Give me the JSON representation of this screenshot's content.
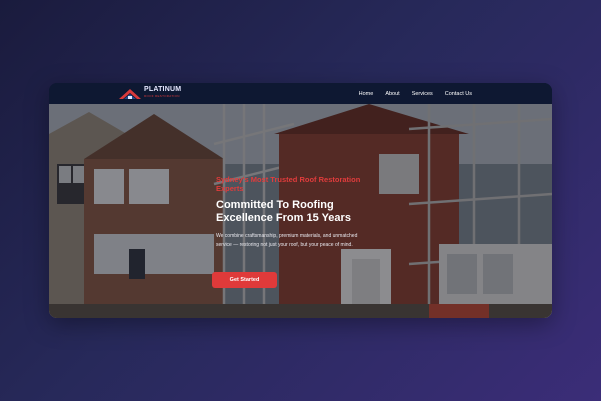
{
  "brand": {
    "name": "PLATINUM",
    "tagline": "ROOF RESTORATION"
  },
  "nav": {
    "items": [
      {
        "label": "Home"
      },
      {
        "label": "About"
      },
      {
        "label": "Services"
      },
      {
        "label": "Contact Us"
      }
    ]
  },
  "hero": {
    "eyebrow": "Sydney's Most Trusted Roof Restoration Experts",
    "headline": "Committed To Roofing Excellence From 15 Years",
    "description": "We combine craftsmanship, premium materials, and unmatched service — restoring not just your roof, but your peace of mind.",
    "cta_label": "Get Started"
  },
  "colors": {
    "accent": "#df3a3a",
    "navbar": "#0e1832",
    "background_start": "#1a1b3d",
    "background_end": "#3b2d78"
  }
}
